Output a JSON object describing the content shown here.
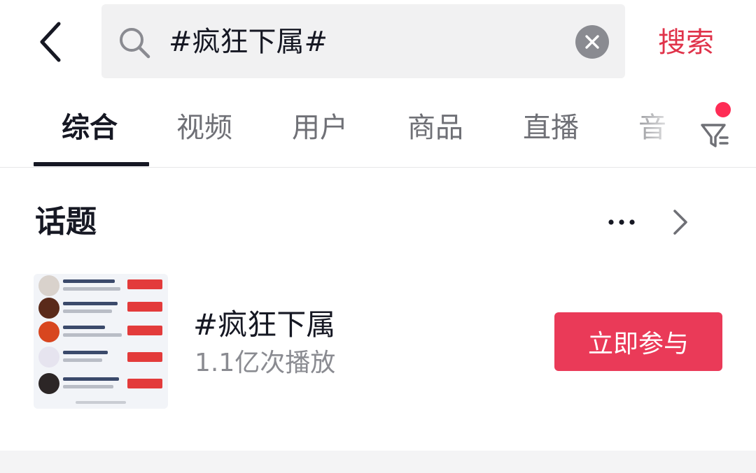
{
  "header": {
    "back_icon": "chevron-left-icon",
    "search": {
      "icon": "search-icon",
      "query": "#疯狂下属#",
      "clear_icon": "close-icon"
    },
    "search_button": "搜索"
  },
  "tabs": [
    {
      "label": "综合",
      "active": true
    },
    {
      "label": "视频",
      "active": false
    },
    {
      "label": "用户",
      "active": false
    },
    {
      "label": "商品",
      "active": false
    },
    {
      "label": "直播",
      "active": false
    },
    {
      "label": "音",
      "active": false
    }
  ],
  "filter": {
    "icon": "filter-icon",
    "has_badge": true
  },
  "section": {
    "title": "话题",
    "more_icon": "more-dots-icon",
    "arrow_icon": "chevron-right-icon"
  },
  "topic": {
    "name": "#疯狂下属",
    "plays": "1.1亿次播放",
    "join_button": "立即参与"
  },
  "colors": {
    "accent": "#e0334a",
    "button": "#ea3a58",
    "badge": "#fe2c55",
    "search_bg": "#f1f1f2",
    "text_primary": "#161823",
    "text_secondary": "#8a8b91"
  }
}
